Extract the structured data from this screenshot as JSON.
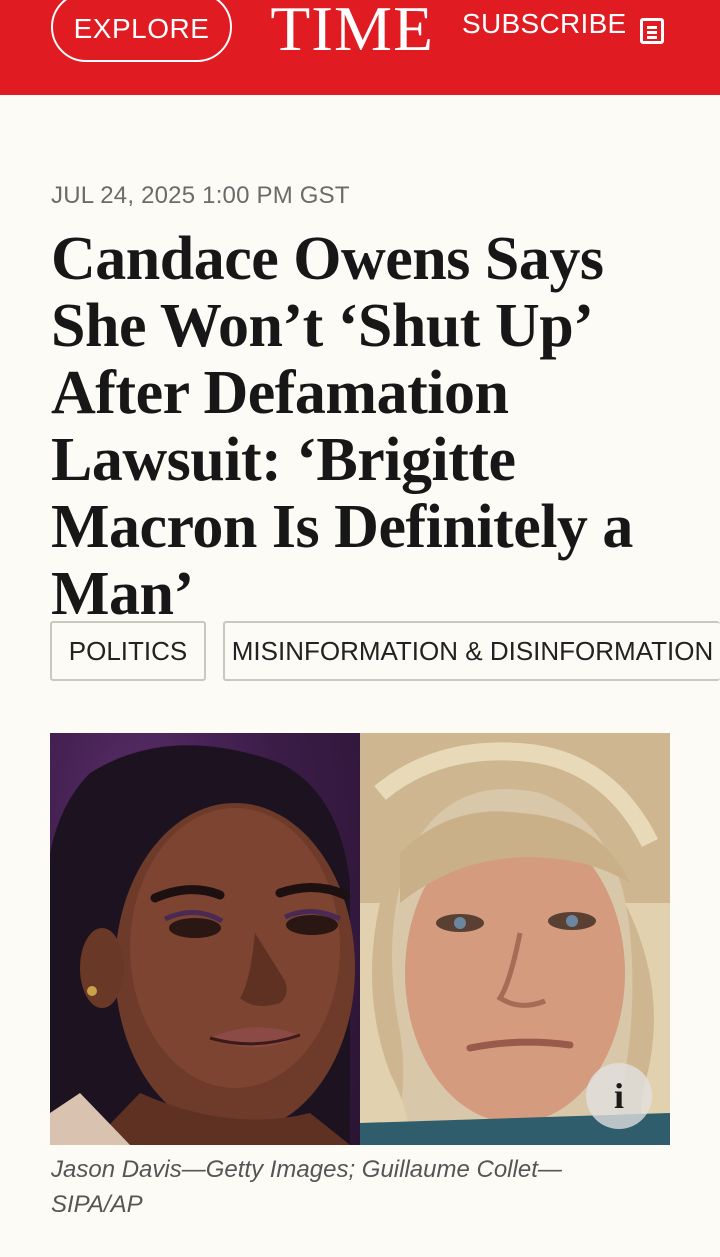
{
  "header": {
    "explore_label": "EXPLORE",
    "logo_text": "TIME",
    "subscribe_label": "SUBSCRIBE",
    "menu_icon": "menu-icon",
    "background_color": "#e11b22"
  },
  "article": {
    "dateline": "JUL 24, 2025 1:00 PM GST",
    "headline": "Candace Owens Says She Won’t ‘Shut Up’ After Defamation Lawsuit: ‘Brigitte Macron Is Definitely a Man’",
    "tags": [
      {
        "label": "POLITICS"
      },
      {
        "label": "MISINFORMATION & DISINFORMATION"
      }
    ],
    "hero_info_label": "i",
    "caption": "Jason Davis—Getty Images; Guillaume Collet—SIPA/AP"
  }
}
